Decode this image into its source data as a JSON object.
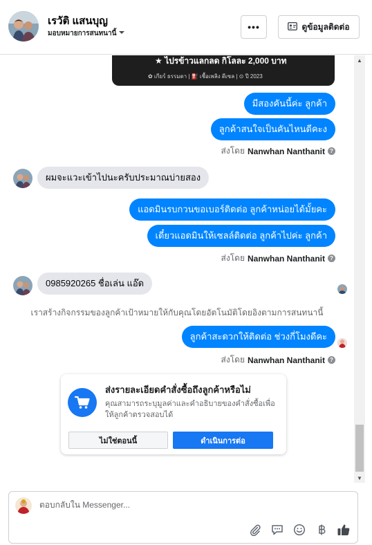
{
  "header": {
    "contact_name": "เรวัติ แสนบุญ",
    "assign_label": "มอบหมายการสนทนานี้",
    "more_label": "•••",
    "info_label": "ดูข้อมูลติดต่อ"
  },
  "promo": {
    "headline": "★ ไปรข้าวแลกลด กิโลละ 2,000 บาท",
    "details": "✿ เกียร์ ธรรมดา  |  ⛽ เชื้อเพลิง ดีเซล  |  ⊙ ปี 2023"
  },
  "messages": {
    "out_1": "มีสองคันนี้ค่ะ ลูกค้า",
    "out_2": "ลูกค้าสนใจเป็นคันไหนดีคะง",
    "sent_by_prefix": "ส่งโดย",
    "sent_by_name": "Nanwhan Nanthanit",
    "in_1": "ผมจะแวะเข้าไปนะครับประมาณบ่ายสอง",
    "out_3": "แอดมินรบกวนขอเบอร์ติดต่อ ลูกค้าหน่อยได้มั้ยคะ",
    "out_4": "เดี๋ยวแอดมินให้เซลล์ติดต่อ ลูกค้าไปค่ะ ลูกค้า",
    "in_2": "0985920265 ชื่อเล่น แอ๊ด",
    "system_note": "เราสร้างกิจกรรมของลูกค้าเป้าหมายให้กับคุณโดยอัตโนมัติโดยอิงตามการสนทนานี้",
    "out_5": "ลูกค้าสะดวกให้ติดต่อ ช่วงกี่โมงดีคะ"
  },
  "order_card": {
    "title": "ส่งรายละเอียดคำสั่งซื้อถึงลูกค้าหรือไม่",
    "description": "คุณสามารถระบุมูลค่าและคำอธิบายของคำสั่งซื้อเพื่อให้ลูกค้าตรวจสอบได้",
    "cancel_label": "ไม่ใช่ตอนนี้",
    "continue_label": "ดำเนินการต่อ"
  },
  "composer": {
    "placeholder": "ตอบกลับใน Messenger..."
  },
  "icons": {
    "attach": "paperclip-icon",
    "quick_reply": "chat-bubble-icon",
    "emoji": "smiley-icon",
    "currency": "baht-icon",
    "like": "thumbs-up-icon"
  },
  "colors": {
    "outgoing_bubble": "#0084ff",
    "incoming_bubble": "#e4e6eb",
    "primary_button": "#1877f2"
  }
}
